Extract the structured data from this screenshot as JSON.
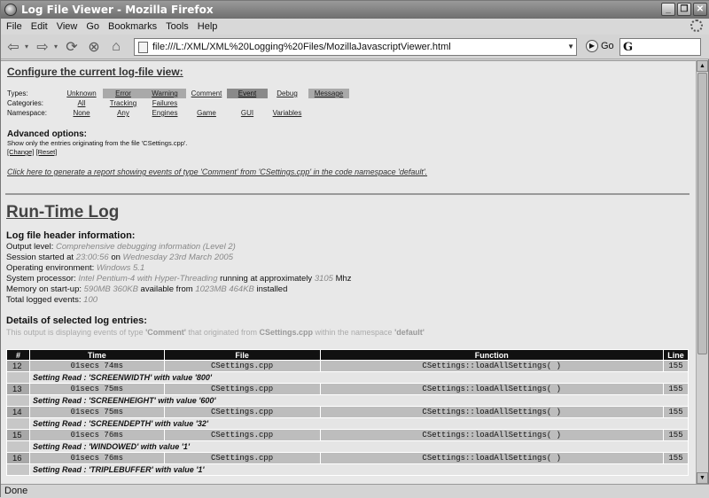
{
  "window": {
    "title": "Log File Viewer - Mozilla Firefox"
  },
  "menu": [
    "File",
    "Edit",
    "View",
    "Go",
    "Bookmarks",
    "Tools",
    "Help"
  ],
  "nav": {
    "url": "file:///L:/XML/XML%20Logging%20Files/MozillaJavascriptViewer.html",
    "go_label": "Go"
  },
  "config": {
    "heading": "Configure the current log-file view:",
    "types_label": "Types:",
    "types": [
      "Unknown",
      "Error",
      "Warning",
      "Comment",
      "Event",
      "Debug",
      "Message"
    ],
    "categories_label": "Categories:",
    "categories": [
      "All",
      "Tracking",
      "Failures"
    ],
    "namespace_label": "Namespace:",
    "namespaces": [
      "None",
      "Any",
      "Engines",
      "Game",
      "GUI",
      "Variables"
    ],
    "advanced_title": "Advanced options:",
    "advanced_text": "Show only the entries originating from the file 'CSettings.cpp'.",
    "change_link": "[Change]",
    "reset_link": "[Reset]",
    "report_link": "Click here to generate a report showing events of type 'Comment' from 'CSettings.cpp' in the code namespace 'default'."
  },
  "log": {
    "title": "Run-Time Log",
    "header_title": "Log file header information:",
    "output_level_label": "Output level:",
    "output_level": "Comprehensive debugging information (Level 2)",
    "session_label": "Session started at",
    "session_time": "23:00:56",
    "session_on": "on",
    "session_date": "Wednesday 23rd March 2005",
    "env_label": "Operating environment:",
    "env": "Windows 5.1",
    "proc_label": "System processor:",
    "proc": "Intel Pentium-4 with Hyper-Threading",
    "proc_mid": "running at approximately",
    "proc_speed": "3105",
    "proc_unit": "Mhz",
    "mem_label": "Memory on start-up:",
    "mem_start": "590MB 360KB",
    "mem_mid": "available from",
    "mem_total": "1023MB 464KB",
    "mem_end": "installed",
    "total_label": "Total logged events:",
    "total": "100",
    "details_title": "Details of selected log entries:",
    "details_pre": "This output is displaying events of type",
    "details_type": "'Comment'",
    "details_mid": "that originated from",
    "details_file": "CSettings.cpp",
    "details_mid2": "within the namespace",
    "details_ns": "'default'"
  },
  "table": {
    "headers": [
      "#",
      "Time",
      "File",
      "Function",
      "Line"
    ],
    "rows": [
      {
        "num": "12",
        "time": "01secs 74ms",
        "file": "CSettings.cpp",
        "func": "CSettings::loadAllSettings( )",
        "line": "155",
        "msg": "Setting Read : 'SCREENWIDTH' with value '800'"
      },
      {
        "num": "13",
        "time": "01secs 75ms",
        "file": "CSettings.cpp",
        "func": "CSettings::loadAllSettings( )",
        "line": "155",
        "msg": "Setting Read : 'SCREENHEIGHT' with value '600'"
      },
      {
        "num": "14",
        "time": "01secs 75ms",
        "file": "CSettings.cpp",
        "func": "CSettings::loadAllSettings( )",
        "line": "155",
        "msg": "Setting Read : 'SCREENDEPTH' with value '32'"
      },
      {
        "num": "15",
        "time": "01secs 76ms",
        "file": "CSettings.cpp",
        "func": "CSettings::loadAllSettings( )",
        "line": "155",
        "msg": "Setting Read : 'WINDOWED' with value '1'"
      },
      {
        "num": "16",
        "time": "01secs 76ms",
        "file": "CSettings.cpp",
        "func": "CSettings::loadAllSettings( )",
        "line": "155",
        "msg": "Setting Read : 'TRIPLEBUFFER' with value '1'"
      }
    ]
  },
  "status": {
    "text": "Done"
  }
}
